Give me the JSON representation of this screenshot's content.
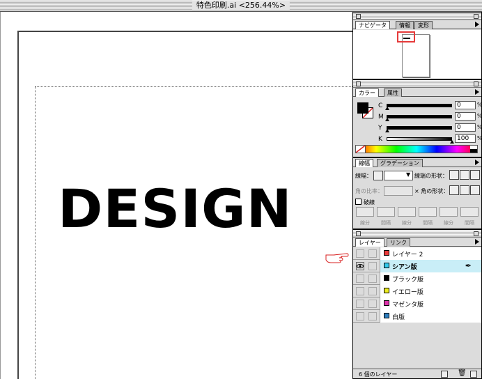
{
  "window": {
    "title": "特色印刷.ai <256.44%>"
  },
  "canvas": {
    "text": "DESIGN"
  },
  "navigator": {
    "tabs": [
      "ナビゲータ",
      "情報",
      "変形"
    ]
  },
  "color": {
    "tabs": [
      "カラー",
      "属性"
    ],
    "sliders": [
      {
        "label": "C",
        "value": "0",
        "unit": "%"
      },
      {
        "label": "M",
        "value": "0",
        "unit": "%"
      },
      {
        "label": "Y",
        "value": "0",
        "unit": "%"
      },
      {
        "label": "K",
        "value": "100",
        "unit": "%"
      }
    ]
  },
  "stroke": {
    "tabs": [
      "線幅",
      "グラデーション"
    ],
    "weight_label": "線幅：",
    "cap_label": "線端の形状：",
    "ratio_label": "角の比率：",
    "join_label": "× 角の形状：",
    "dash_label": "破線",
    "dash_cells": [
      "線分",
      "間隔",
      "線分",
      "間隔",
      "線分",
      "間隔"
    ]
  },
  "layers": {
    "tabs": [
      "レイヤー",
      "リンク"
    ],
    "items": [
      {
        "name": "レイヤー 2",
        "color": "#e83a3a"
      },
      {
        "name": "シアン版",
        "color": "#33ccee"
      },
      {
        "name": "ブラック版",
        "color": "#000000"
      },
      {
        "name": "イエロー版",
        "color": "#eeee22"
      },
      {
        "name": "マゼンタ版",
        "color": "#dd33aa"
      },
      {
        "name": "白版",
        "color": "#2f7fbf"
      }
    ],
    "count_label": "6 個のレイヤー"
  }
}
